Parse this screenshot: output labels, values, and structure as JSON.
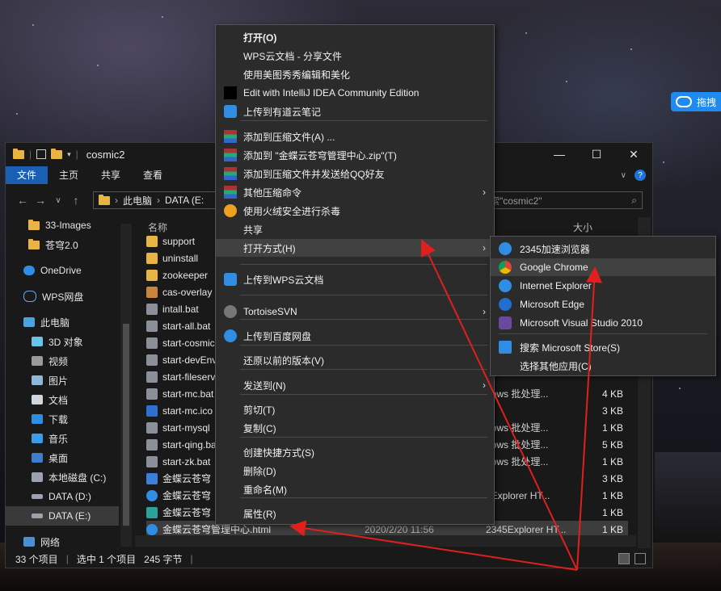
{
  "baidu_widget": {
    "label": "拖拽"
  },
  "window": {
    "title": "cosmic2",
    "controls": {
      "minimize": "—",
      "maximize": "☐",
      "close": "✕"
    },
    "ribbon_tabs": [
      "文件",
      "主页",
      "共享",
      "查看"
    ],
    "nav": {
      "back": "←",
      "forward": "→",
      "down": "∨",
      "up": "↑"
    },
    "address": [
      "此电脑",
      "DATA (E:"
    ],
    "search_placeholder": "索\"cosmic2\"",
    "columns": {
      "name": "名称",
      "size": "大小"
    },
    "sidebar": [
      {
        "label": "33-Images",
        "icon": "folder-icon"
      },
      {
        "label": "苍穹2.0",
        "icon": "folder-icon"
      },
      {
        "label": "OneDrive",
        "icon": "cloud-icon"
      },
      {
        "label": "WPS网盘",
        "icon": "cloud-icon"
      },
      {
        "label": "此电脑",
        "icon": "computer-icon"
      },
      {
        "label": "3D 对象",
        "icon": "cube-icon"
      },
      {
        "label": "视频",
        "icon": "video-icon"
      },
      {
        "label": "图片",
        "icon": "picture-icon"
      },
      {
        "label": "文档",
        "icon": "document-icon"
      },
      {
        "label": "下载",
        "icon": "download-icon"
      },
      {
        "label": "音乐",
        "icon": "music-icon"
      },
      {
        "label": "桌面",
        "icon": "desktop-icon"
      },
      {
        "label": "本地磁盘 (C:)",
        "icon": "drive-icon"
      },
      {
        "label": "DATA (D:)",
        "icon": "drive-icon"
      },
      {
        "label": "DATA (E:)",
        "icon": "drive-icon"
      },
      {
        "label": "网络",
        "icon": "network-icon"
      }
    ],
    "files": [
      {
        "name": "support",
        "type": "",
        "size": "",
        "icon": "folder"
      },
      {
        "name": "uninstall",
        "type": "",
        "size": "",
        "icon": "folder"
      },
      {
        "name": "zookeeper",
        "type": "",
        "size": "",
        "icon": "folder"
      },
      {
        "name": "cas-overlay",
        "type": "",
        "size": "",
        "icon": "archive"
      },
      {
        "name": "intall.bat",
        "type": "",
        "size": "",
        "icon": "bat"
      },
      {
        "name": "start-all.bat",
        "type": "",
        "size": "",
        "icon": "bat"
      },
      {
        "name": "start-cosmic",
        "type": "",
        "size": "",
        "icon": "bat"
      },
      {
        "name": "start-devEnv",
        "type": "",
        "size": "",
        "icon": "bat"
      },
      {
        "name": "start-fileserver",
        "type": "",
        "size": "",
        "icon": "bat"
      },
      {
        "name": "start-mc.bat",
        "type": "dows 批处理...",
        "size": "4 KB",
        "icon": "bat"
      },
      {
        "name": "start-mc.ico",
        "type": "",
        "size": "3 KB",
        "icon": "ico"
      },
      {
        "name": "start-mysql",
        "type": "dows 批处理...",
        "size": "1 KB",
        "icon": "bat"
      },
      {
        "name": "start-qing.bat",
        "type": "dows 批处理...",
        "size": "5 KB",
        "icon": "bat"
      },
      {
        "name": "start-zk.bat",
        "type": "dows 批处理...",
        "size": "1 KB",
        "icon": "bat"
      },
      {
        "name": "金蝶云苍穹",
        "type": "",
        "size": "3 KB",
        "icon": "app"
      },
      {
        "name": "金蝶云苍穹",
        "type": "5Explorer HT...",
        "size": "1 KB",
        "icon": "ie"
      },
      {
        "name": "金蝶云苍穹",
        "type": "",
        "size": "1 KB",
        "icon": "app2"
      },
      {
        "name": "金蝶云苍穹管理中心.html",
        "date": "2020/2/20 11:56",
        "type": "2345Explorer HT...",
        "size": "1 KB",
        "icon": "ie"
      }
    ],
    "status": {
      "count": "33 个项目",
      "selected": "选中 1 个项目",
      "bytes": "245 字节"
    }
  },
  "context_menu": {
    "items": [
      {
        "label": "打开(O)",
        "bold": true
      },
      {
        "label": "WPS云文档 - 分享文件",
        "icon": "share-icon"
      },
      {
        "label": "使用美图秀秀编辑和美化"
      },
      {
        "label": "Edit with IntelliJ IDEA Community Edition",
        "icon": "intellij-icon"
      },
      {
        "label": "上传到有道云笔记",
        "icon": "youdao-icon"
      },
      {
        "label": "添加到压缩文件(A) ...",
        "icon": "winrar-icon"
      },
      {
        "label": "添加到 \"金蝶云苍穹管理中心.zip\"(T)",
        "icon": "winrar-icon"
      },
      {
        "label": "添加到压缩文件并发送给QQ好友",
        "icon": "winrar-icon"
      },
      {
        "label": "其他压缩命令",
        "icon": "winrar-icon",
        "submenu": true
      },
      {
        "label": "使用火绒安全进行杀毒",
        "icon": "huorong-icon"
      },
      {
        "label": "共享",
        "icon": "share-arrow-icon"
      },
      {
        "label": "打开方式(H)",
        "submenu": true
      },
      {
        "label": "上传到WPS云文档",
        "icon": "wps-cloud-icon"
      },
      {
        "label": "TortoiseSVN",
        "icon": "tortoise-icon",
        "submenu": true
      },
      {
        "label": "上传到百度网盘",
        "icon": "baidu-icon"
      },
      {
        "label": "还原以前的版本(V)"
      },
      {
        "label": "发送到(N)",
        "submenu": true
      },
      {
        "label": "剪切(T)"
      },
      {
        "label": "复制(C)"
      },
      {
        "label": "创建快捷方式(S)"
      },
      {
        "label": "删除(D)"
      },
      {
        "label": "重命名(M)"
      },
      {
        "label": "属性(R)"
      }
    ],
    "arrow": "›"
  },
  "open_with": {
    "items": [
      {
        "label": "2345加速浏览器",
        "icon": "2345-icon"
      },
      {
        "label": "Google Chrome",
        "icon": "chrome-icon"
      },
      {
        "label": "Internet Explorer",
        "icon": "ie-icon"
      },
      {
        "label": "Microsoft Edge",
        "icon": "edge-icon"
      },
      {
        "label": "Microsoft Visual Studio 2010",
        "icon": "vs-icon"
      },
      {
        "label": "搜索 Microsoft Store(S)",
        "icon": "store-icon"
      },
      {
        "label": "选择其他应用(C)"
      }
    ]
  },
  "colors": {
    "accent": "#1a5fb4",
    "annotation": "#e0201c",
    "menu_bg": "#2b2b2b"
  }
}
